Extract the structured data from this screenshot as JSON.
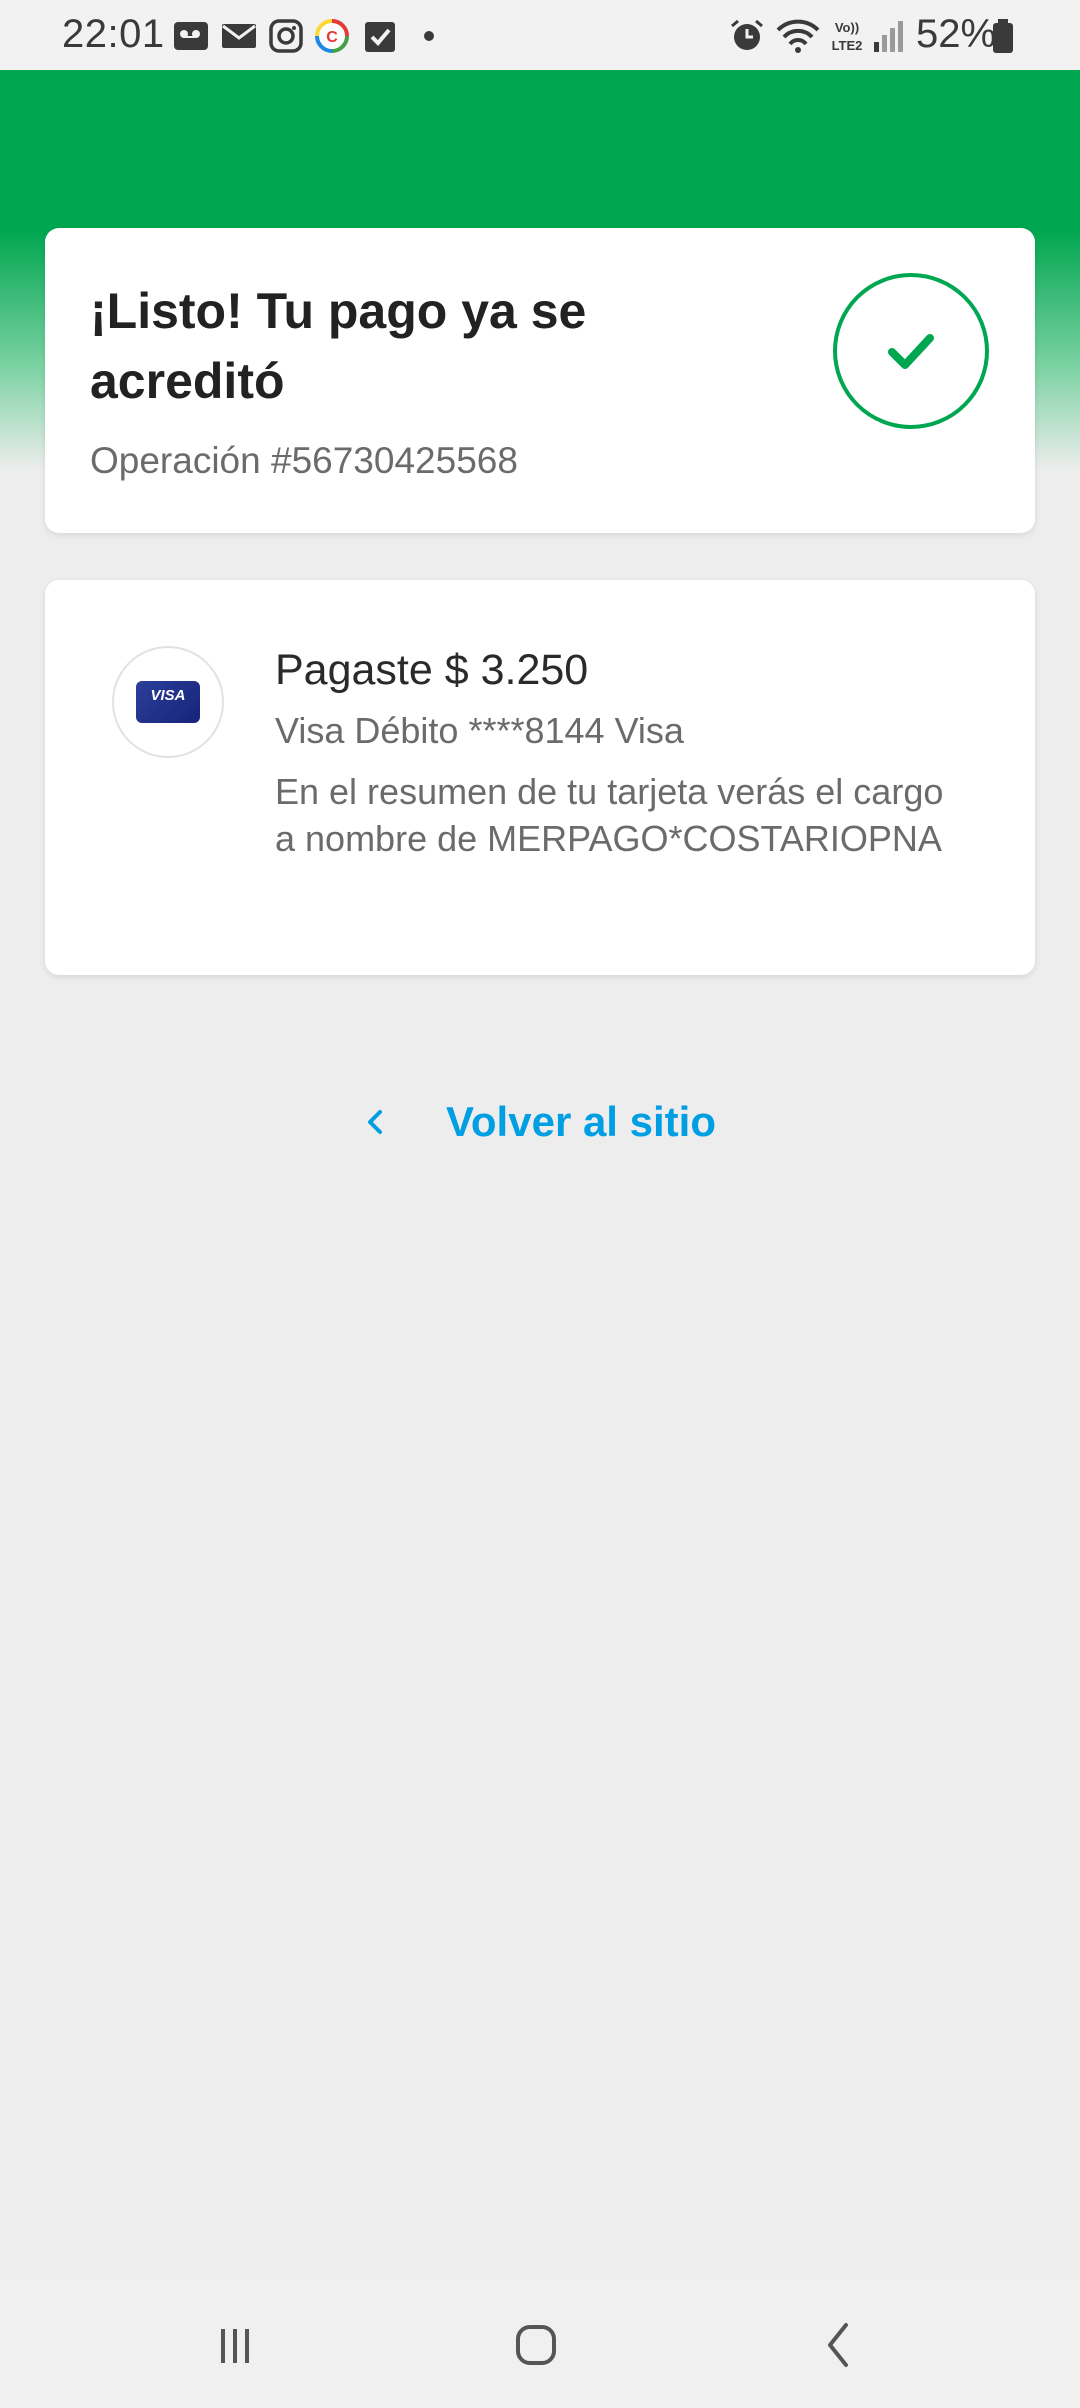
{
  "status_bar": {
    "time": "22:01",
    "battery_percent": "52%",
    "network_label": "LTE2",
    "left_icons": [
      "voicemail-icon",
      "email-icon",
      "instagram-icon",
      "app-c-icon",
      "task-check-icon",
      "dot-icon"
    ],
    "right_icons": [
      "alarm-icon",
      "wifi-icon",
      "volte-icon",
      "signal-icon",
      "battery-icon"
    ]
  },
  "success": {
    "title": "¡Listo! Tu pago ya se acreditó",
    "operation": "Operación #56730425568",
    "icon": "check-icon"
  },
  "payment": {
    "amount_text": "Pagaste $ 3.250",
    "method_text": "Visa Débito ****8144 Visa",
    "note_text": "En el resumen de tu tarjeta verás el cargo a nombre de MERPAGO*COSTARIOPNA",
    "card_brand": "VISA"
  },
  "actions": {
    "back_label": "Volver al sitio"
  },
  "colors": {
    "brand_green": "#00a650",
    "link_blue": "#009ee3",
    "background": "#ededed"
  },
  "nav": {
    "icons": [
      "recent-apps-icon",
      "home-icon",
      "back-icon"
    ]
  }
}
